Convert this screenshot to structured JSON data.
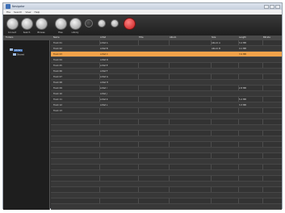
{
  "window": {
    "title": "Navigator",
    "menu": [
      "File",
      "Search",
      "View",
      "Help"
    ]
  },
  "toolbar": {
    "buttons": [
      {
        "icon": "globe-icon",
        "label": "Connect"
      },
      {
        "icon": "globe-icon",
        "label": "Search"
      },
      {
        "icon": "globe-icon",
        "label": "Browse"
      },
      {
        "icon": "globe-icon",
        "label": "Files"
      },
      {
        "icon": "globe-icon",
        "label": "Library"
      },
      {
        "icon": "music-note-icon",
        "label": ""
      },
      {
        "icon": "arrow-icon",
        "label": ""
      },
      {
        "icon": "arrow-icon",
        "label": ""
      },
      {
        "icon": "stop-icon",
        "label": ""
      }
    ]
  },
  "header": {
    "left_label": "Folders",
    "columns": [
      "Name",
      "Artist",
      "Title",
      "Album",
      "Size",
      "Length",
      "Bitrate"
    ]
  },
  "tree": [
    {
      "label": "Library",
      "selected": true
    },
    {
      "label": "Shared",
      "selected": false
    }
  ],
  "rows": [
    [
      "Track 01",
      "Artist A",
      "",
      "",
      "Album A",
      "3.4 MB",
      ""
    ],
    [
      "Track 02",
      "Artist B",
      "",
      "",
      "Album B",
      "4.1 MB",
      ""
    ],
    [
      "Track 03",
      "Artist C",
      "",
      "",
      "",
      "3.9 MB",
      ""
    ],
    [
      "Track 04",
      "Artist D",
      "",
      "",
      "",
      "",
      ""
    ],
    [
      "Track 05",
      "Artist E",
      "",
      "",
      "",
      "",
      ""
    ],
    [
      "Track 06",
      "Artist F",
      "",
      "",
      "",
      "",
      ""
    ],
    [
      "Track 07",
      "Artist G",
      "",
      "",
      "",
      "",
      ""
    ],
    [
      "Track 08",
      "Artist H",
      "",
      "",
      "",
      "",
      ""
    ],
    [
      "Track 09",
      "Artist I",
      "",
      "",
      "",
      "2.8 MB",
      ""
    ],
    [
      "Track 10",
      "Artist J",
      "",
      "",
      "",
      "",
      ""
    ],
    [
      "Track 11",
      "Artist K",
      "",
      "",
      "",
      "5.2 MB",
      ""
    ],
    [
      "Track 12",
      "Artist L",
      "",
      "",
      "",
      "3.3 MB",
      ""
    ],
    [
      "Track 13",
      "",
      "",
      "",
      "",
      "",
      ""
    ]
  ],
  "selected_row": 2
}
